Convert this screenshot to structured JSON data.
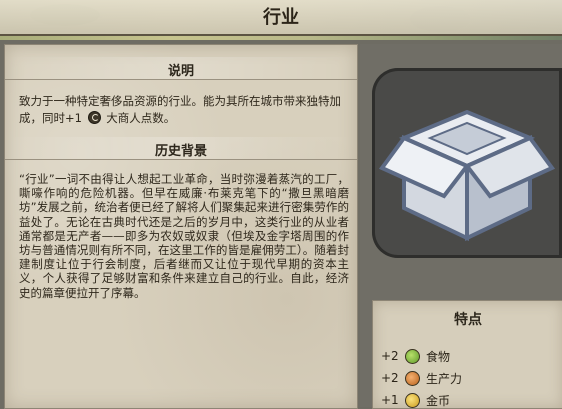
{
  "header": {
    "title": "行业"
  },
  "description": {
    "heading": "说明",
    "text_before_icon": "致力于一种特定奢侈品资源的行业。能为其所在城市带来独特加成，同时+1",
    "icon": "great-merchant-turn-icon",
    "text_after_icon": "大商人点数。"
  },
  "history": {
    "heading": "历史背景",
    "text": "“行业”一词不由得让人想起工业革命，当时弥漫着蒸汽的工厂，嘶嚎作响的危险机器。但早在威廉·布莱克笔下的“撒旦黑暗磨坊”发展之前，统治者便已经了解将人们聚集起来进行密集劳作的益处了。无论在古典时代还是之后的岁月中，这类行业的从业者通常都是无产者——即多为农奴或奴隶（但埃及金字塔周围的作坊与普通情况则有所不同，在这里工作的皆是雇佣劳工）。随着封建制度让位于行会制度，后者继而又让位于现代早期的资本主义，个人获得了足够财富和条件来建立自己的行业。自此，经济史的篇章便拉开了序幕。"
  },
  "item_icon": "industry-crate-icon",
  "traits": {
    "heading": "特点",
    "rows": [
      {
        "amount": "+2",
        "icon": "food-icon",
        "label": "食物"
      },
      {
        "amount": "+2",
        "icon": "production-icon",
        "label": "生产力"
      },
      {
        "amount": "+1",
        "icon": "gold-icon",
        "label": "金币"
      }
    ]
  },
  "colors": {
    "parchment": "#d8d0bd",
    "panel": "#706e66",
    "crate_light": "#e4e7ec",
    "crate_edge": "#5d6b86",
    "text": "#2f281c"
  }
}
